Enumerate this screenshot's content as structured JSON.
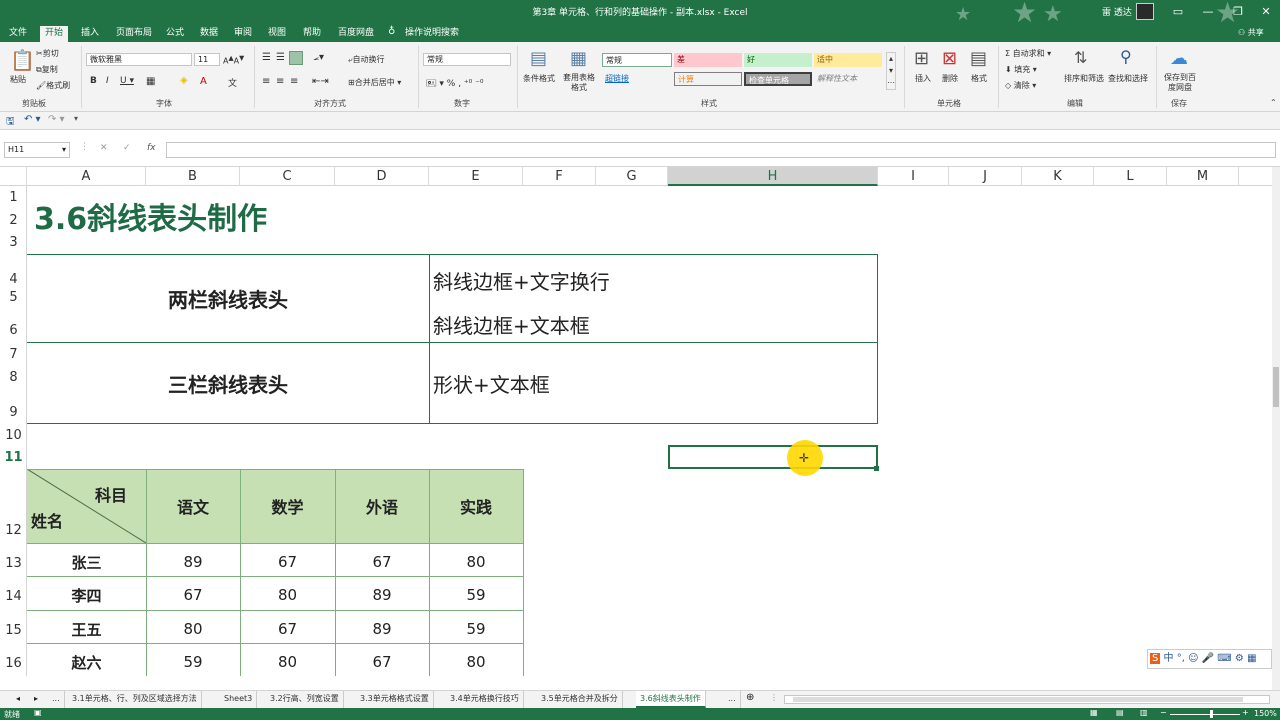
{
  "window": {
    "title": "第3章 单元格、行和列的基础操作 - 副本.xlsx  -  Excel",
    "account": "雷 透达",
    "share": "共享"
  },
  "tabs": [
    "文件",
    "开始",
    "插入",
    "页面布局",
    "公式",
    "数据",
    "审阅",
    "视图",
    "帮助",
    "百度网盘",
    "操作说明搜索"
  ],
  "ribbon": {
    "clipboard": {
      "paste": "粘贴",
      "cut": "剪切",
      "copy": "复制",
      "format_painter": "格式刷",
      "label": "剪贴板"
    },
    "font": {
      "name": "微软雅黑",
      "size": "11",
      "label": "字体"
    },
    "alignment": {
      "wrap": "自动换行",
      "merge": "合并后居中",
      "label": "对齐方式"
    },
    "number": {
      "format": "常规",
      "label": "数字"
    },
    "styles": {
      "cond": "条件格式",
      "table": "套用表格格式",
      "normal": "常规",
      "bad": "差",
      "good": "好",
      "neutral": "适中",
      "hyperlink": "超链接",
      "calc": "计算",
      "check": "检查单元格",
      "explain": "解释性文本",
      "label": "样式"
    },
    "cells": {
      "insert": "插入",
      "delete": "删除",
      "format": "格式",
      "label": "单元格"
    },
    "editing": {
      "autosum": "自动求和",
      "fill": "填充",
      "clear": "清除",
      "sort": "排序和筛选",
      "find": "查找和选择",
      "label": "编辑"
    },
    "save": {
      "btn": "保存到百度网盘",
      "label": "保存"
    }
  },
  "formula_bar": {
    "name_box": "H11",
    "fx": "fx",
    "value": ""
  },
  "columns": [
    "A",
    "B",
    "C",
    "D",
    "E",
    "F",
    "G",
    "H",
    "I",
    "J",
    "K",
    "L",
    "M"
  ],
  "rows": [
    "1",
    "2",
    "3",
    "4",
    "5",
    "6",
    "7",
    "8",
    "9",
    "10",
    "11",
    "12",
    "13",
    "14",
    "15",
    "16"
  ],
  "sheet": {
    "title": "3.6斜线表头制作",
    "two_col": "两栏斜线表头",
    "two_col_m1": "斜线边框+文字换行",
    "two_col_m2": "斜线边框+文本框",
    "three_col": "三栏斜线表头",
    "three_col_m": "形状+文本框",
    "header_subject": "科目",
    "header_name": "姓名",
    "subjects": [
      "语文",
      "数学",
      "外语",
      "实践"
    ],
    "students": [
      {
        "name": "张三",
        "scores": [
          "89",
          "67",
          "67",
          "80"
        ]
      },
      {
        "name": "李四",
        "scores": [
          "67",
          "80",
          "89",
          "59"
        ]
      },
      {
        "name": "王五",
        "scores": [
          "80",
          "67",
          "89",
          "59"
        ]
      },
      {
        "name": "赵六",
        "scores": [
          "59",
          "80",
          "67",
          "80"
        ]
      }
    ]
  },
  "sheet_tabs": [
    "...",
    "3.1单元格、行、列及区域选择方法",
    "Sheet3",
    "3.2行高、列宽设置",
    "3.3单元格格式设置",
    "3.4单元格换行技巧",
    "3.5单元格合并及拆分",
    "3.6斜线表头制作",
    "..."
  ],
  "status": {
    "ready": "就绪",
    "zoom": "150%"
  },
  "colors": {
    "excel_green": "#217346",
    "header_fill": "#c6e0b4",
    "title_green": "#1f6b45"
  }
}
